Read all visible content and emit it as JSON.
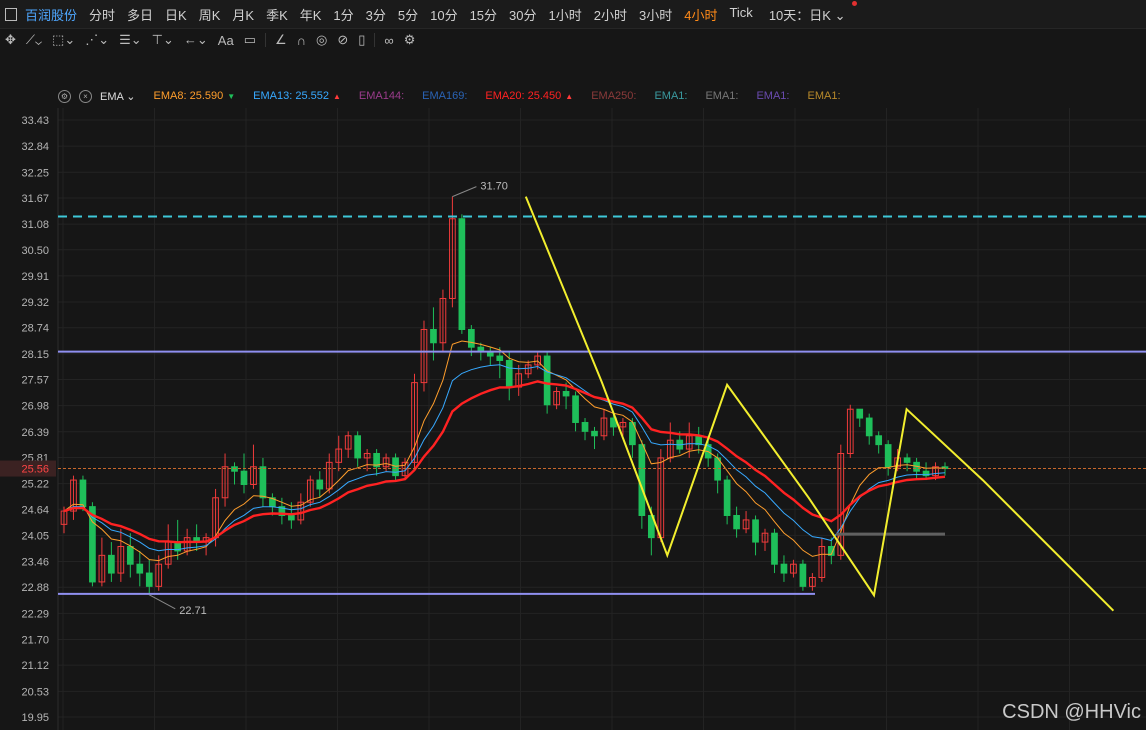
{
  "topbar": {
    "title": "百润股份",
    "timeframes": [
      "分时",
      "多日",
      "日K",
      "周K",
      "月K",
      "季K",
      "年K",
      "1分",
      "3分",
      "5分",
      "10分",
      "15分",
      "30分",
      "1小时",
      "2小时",
      "3小时",
      "4小时",
      "Tick"
    ],
    "active_timeframe": "4小时",
    "range": "10天：日K"
  },
  "toolbar": {
    "icons": [
      "crosshair-icon",
      "line-tool-icon",
      "rect-tool-icon",
      "pattern-tool-icon",
      "fib-tool-icon",
      "text-tool-icon",
      "measure-tool-icon",
      "font-tool-icon",
      "comment-icon",
      "pencil-icon",
      "magnet-icon",
      "eye-icon",
      "hide-icon",
      "trash-icon",
      "link-icon",
      "settings-icon"
    ],
    "font_label": "Aa"
  },
  "indicator_bar": {
    "name": "EMA",
    "items": [
      {
        "label": "EMA8:",
        "value": "25.590",
        "arrow": "▼",
        "color": "#ff9e2c",
        "arrow_color": "#1fbf5a"
      },
      {
        "label": "EMA13:",
        "value": "25.552",
        "arrow": "▲",
        "color": "#37a9ff",
        "arrow_color": "#ff3a3a"
      },
      {
        "label": "EMA144:",
        "value": "",
        "arrow": "",
        "color": "#9b3c8c"
      },
      {
        "label": "EMA169:",
        "value": "",
        "arrow": "",
        "color": "#2a63b5"
      },
      {
        "label": "EMA20:",
        "value": "25.450",
        "arrow": "▲",
        "color": "#ff2222",
        "arrow_color": "#ff3a3a"
      },
      {
        "label": "EMA250:",
        "value": "",
        "arrow": "",
        "color": "#8a3a3a"
      },
      {
        "label": "EMA1:",
        "value": "",
        "arrow": "",
        "color": "#3a9aa0"
      },
      {
        "label": "EMA1:",
        "value": "",
        "arrow": "",
        "color": "#777777"
      },
      {
        "label": "EMA1:",
        "value": "",
        "arrow": "",
        "color": "#6a4bb0"
      },
      {
        "label": "EMA1:",
        "value": "",
        "arrow": "",
        "color": "#b88a2a"
      }
    ]
  },
  "chart_data": {
    "type": "candlestick",
    "y_ticks": [
      "33.43",
      "32.84",
      "32.25",
      "31.67",
      "31.08",
      "30.50",
      "29.91",
      "29.32",
      "28.74",
      "28.15",
      "27.57",
      "26.98",
      "26.39",
      "25.81",
      "25.22",
      "24.64",
      "24.05",
      "23.46",
      "22.88",
      "22.29",
      "21.70",
      "21.12",
      "20.53",
      "19.95"
    ],
    "ylim": [
      19.95,
      33.43
    ],
    "current_price": "25.56",
    "high_label": "31.70",
    "low_label": "22.71",
    "horizontal_lines": [
      {
        "value": 31.25,
        "style": "dashed",
        "color": "#3ec8d8"
      },
      {
        "value": 28.2,
        "style": "solid",
        "color": "#8f8ff0"
      },
      {
        "value": 22.73,
        "style": "solid",
        "color": "#8f8ff0"
      },
      {
        "value": 24.08,
        "style": "solid",
        "color": "#606060"
      }
    ],
    "zigzag": [
      [
        0.43,
        31.7
      ],
      [
        0.5,
        27.5
      ],
      [
        0.56,
        23.6
      ],
      [
        0.615,
        27.45
      ],
      [
        0.69,
        24.9
      ],
      [
        0.75,
        22.7
      ],
      [
        0.78,
        26.9
      ],
      [
        0.85,
        25.3
      ],
      [
        0.97,
        22.35
      ]
    ],
    "zigzag_color": "#f2ee2e",
    "ema_colors": {
      "ema8": "#ff9e2c",
      "ema13": "#37a9ff",
      "ema20": "#ff2222"
    },
    "up_color": "#ef3b3b",
    "down_color": "#1fbf5a",
    "candles": [
      [
        24.3,
        24.6,
        24.1,
        24.7
      ],
      [
        24.6,
        25.3,
        24.4,
        25.4
      ],
      [
        25.3,
        24.7,
        24.6,
        25.4
      ],
      [
        24.7,
        23.0,
        22.9,
        24.8
      ],
      [
        23.0,
        23.6,
        22.9,
        24.0
      ],
      [
        23.6,
        23.2,
        23.0,
        23.9
      ],
      [
        23.2,
        23.8,
        23.0,
        24.2
      ],
      [
        23.8,
        23.4,
        23.1,
        24.1
      ],
      [
        23.4,
        23.2,
        22.9,
        23.7
      ],
      [
        23.2,
        22.9,
        22.7,
        23.5
      ],
      [
        22.9,
        23.4,
        22.8,
        23.6
      ],
      [
        23.4,
        23.9,
        23.3,
        24.3
      ],
      [
        23.9,
        23.7,
        23.5,
        24.4
      ],
      [
        23.7,
        24.0,
        23.6,
        24.2
      ],
      [
        24.0,
        23.9,
        23.7,
        24.3
      ],
      [
        23.9,
        24.0,
        23.6,
        24.1
      ],
      [
        24.0,
        24.9,
        23.8,
        25.1
      ],
      [
        24.9,
        25.6,
        24.7,
        25.9
      ],
      [
        25.6,
        25.5,
        25.2,
        25.7
      ],
      [
        25.5,
        25.2,
        25.0,
        25.9
      ],
      [
        25.2,
        25.6,
        25.1,
        26.1
      ],
      [
        25.6,
        24.9,
        24.7,
        25.8
      ],
      [
        24.9,
        24.7,
        24.5,
        25.0
      ],
      [
        24.7,
        24.5,
        24.3,
        24.9
      ],
      [
        24.5,
        24.4,
        24.2,
        24.8
      ],
      [
        24.4,
        24.8,
        24.3,
        25.0
      ],
      [
        24.8,
        25.3,
        24.7,
        25.4
      ],
      [
        25.3,
        25.1,
        24.9,
        25.5
      ],
      [
        25.1,
        25.7,
        25.0,
        25.9
      ],
      [
        25.7,
        26.0,
        25.5,
        26.3
      ],
      [
        26.0,
        26.3,
        25.8,
        26.4
      ],
      [
        26.3,
        25.8,
        25.6,
        26.4
      ],
      [
        25.8,
        25.9,
        25.5,
        26.0
      ],
      [
        25.9,
        25.6,
        25.4,
        26.0
      ],
      [
        25.6,
        25.8,
        25.5,
        25.9
      ],
      [
        25.8,
        25.4,
        25.3,
        25.9
      ],
      [
        25.4,
        25.7,
        25.3,
        25.8
      ],
      [
        25.7,
        27.5,
        25.5,
        27.7
      ],
      [
        27.5,
        28.7,
        27.3,
        28.9
      ],
      [
        28.7,
        28.4,
        28.0,
        29.2
      ],
      [
        28.4,
        29.4,
        28.2,
        29.6
      ],
      [
        29.4,
        31.2,
        29.2,
        31.7
      ],
      [
        31.2,
        28.7,
        28.6,
        31.3
      ],
      [
        28.7,
        28.3,
        28.1,
        28.8
      ],
      [
        28.3,
        28.2,
        28.0,
        28.4
      ],
      [
        28.2,
        28.1,
        27.9,
        28.3
      ],
      [
        28.1,
        28.0,
        27.6,
        28.3
      ],
      [
        28.0,
        27.4,
        27.1,
        28.2
      ],
      [
        27.4,
        27.7,
        27.2,
        27.9
      ],
      [
        27.7,
        27.9,
        27.6,
        28.0
      ],
      [
        27.9,
        28.1,
        27.8,
        28.2
      ],
      [
        28.1,
        27.0,
        26.8,
        28.2
      ],
      [
        27.0,
        27.3,
        26.9,
        27.4
      ],
      [
        27.3,
        27.2,
        26.9,
        27.5
      ],
      [
        27.2,
        26.6,
        26.4,
        27.3
      ],
      [
        26.6,
        26.4,
        26.2,
        26.7
      ],
      [
        26.4,
        26.3,
        26.0,
        26.5
      ],
      [
        26.3,
        26.7,
        26.2,
        26.9
      ],
      [
        26.7,
        26.5,
        26.3,
        26.8
      ],
      [
        26.5,
        26.6,
        26.3,
        26.7
      ],
      [
        26.6,
        26.1,
        25.8,
        26.7
      ],
      [
        26.1,
        24.5,
        24.2,
        26.2
      ],
      [
        24.5,
        24.0,
        23.6,
        24.7
      ],
      [
        24.0,
        25.8,
        23.9,
        26.0
      ],
      [
        25.8,
        26.2,
        25.7,
        26.6
      ],
      [
        26.2,
        26.0,
        25.9,
        26.4
      ],
      [
        26.0,
        26.3,
        25.8,
        26.6
      ],
      [
        26.3,
        26.1,
        25.9,
        26.5
      ],
      [
        26.1,
        25.8,
        25.6,
        26.3
      ],
      [
        25.8,
        25.3,
        25.0,
        25.9
      ],
      [
        25.3,
        24.5,
        24.3,
        25.4
      ],
      [
        24.5,
        24.2,
        24.0,
        24.7
      ],
      [
        24.2,
        24.4,
        24.1,
        24.6
      ],
      [
        24.4,
        23.9,
        23.6,
        24.5
      ],
      [
        23.9,
        24.1,
        23.7,
        24.2
      ],
      [
        24.1,
        23.4,
        23.2,
        24.2
      ],
      [
        23.4,
        23.2,
        23.0,
        23.6
      ],
      [
        23.2,
        23.4,
        23.1,
        23.5
      ],
      [
        23.4,
        22.9,
        22.8,
        23.5
      ],
      [
        22.9,
        23.1,
        22.8,
        23.2
      ],
      [
        23.1,
        23.8,
        23.0,
        24.0
      ],
      [
        23.8,
        23.6,
        23.4,
        24.0
      ],
      [
        23.6,
        25.9,
        23.5,
        26.1
      ],
      [
        25.9,
        26.9,
        25.8,
        27.0
      ],
      [
        26.9,
        26.7,
        26.5,
        26.9
      ],
      [
        26.7,
        26.3,
        26.1,
        26.8
      ],
      [
        26.3,
        26.1,
        25.9,
        26.4
      ],
      [
        26.1,
        25.6,
        25.4,
        26.2
      ],
      [
        25.6,
        25.8,
        25.5,
        26.0
      ],
      [
        25.8,
        25.7,
        25.5,
        25.9
      ],
      [
        25.7,
        25.5,
        25.3,
        25.8
      ],
      [
        25.5,
        25.4,
        25.3,
        25.7
      ],
      [
        25.4,
        25.6,
        25.3,
        25.7
      ],
      [
        25.6,
        25.56,
        25.4,
        25.7
      ]
    ]
  },
  "watermark": "CSDN @HHVic"
}
